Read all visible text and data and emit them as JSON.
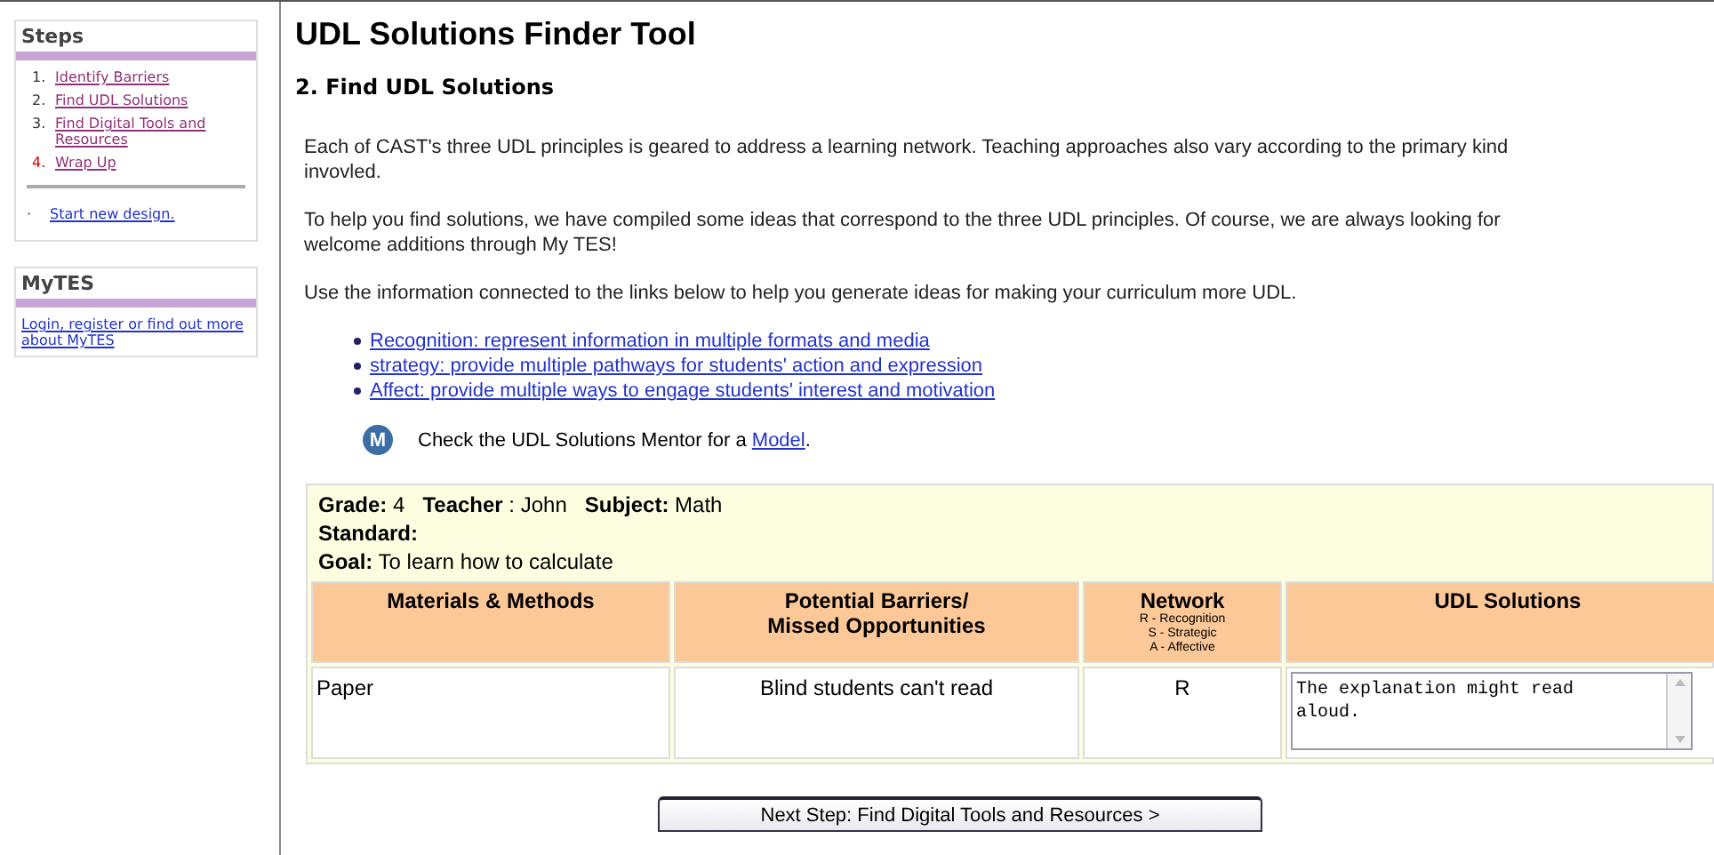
{
  "sidebar": {
    "steps_box": {
      "title": "Steps",
      "steps": [
        {
          "number": "1.",
          "label": "Identify Barriers",
          "highlighted": false
        },
        {
          "number": "2.",
          "label": "Find UDL Solutions",
          "highlighted": false
        },
        {
          "number": "3.",
          "label": "Find Digital Tools and Resources",
          "highlighted": false
        },
        {
          "number": "4.",
          "label": "Wrap Up",
          "highlighted": true
        }
      ],
      "extra_link": {
        "bullet": "·",
        "label": "Start new design."
      }
    },
    "mytes_box": {
      "title": "MyTES",
      "link": "Login, register or find out more about MyTES"
    }
  },
  "main": {
    "title": "UDL Solutions Finder Tool",
    "subtitle": "2. Find UDL Solutions",
    "paragraphs": [
      [
        "Each of CAST's three UDL principles is geared to address a learning network. Teaching approaches also vary according to the primary kind",
        "invovled."
      ],
      [
        "To help you find solutions, we have compiled some ideas that correspond to the three UDL principles. Of course, we are always looking for",
        "welcome additions through My TES!"
      ],
      [
        "Use the information connected to the links below to help you generate ideas for making your curriculum more UDL."
      ]
    ],
    "links": [
      "Recognition: represent information in multiple formats and media",
      "strategy: provide multiple pathways for students' action and expression",
      "Affect: provide multiple ways to engage students' interest and motivation"
    ],
    "mentor": {
      "icon_letter": "M",
      "text": "Check the UDL Solutions Mentor for a ",
      "link": "Model",
      "after": "."
    },
    "plan": {
      "info": [
        {
          "label": "Grade:",
          "value": "4"
        },
        {
          "label": "Teacher",
          "value": ": John"
        },
        {
          "label": "Subject:",
          "value": "Math"
        }
      ],
      "standard_label": "Standard:",
      "goal_label": "Goal:",
      "goal": "To learn how to calculate",
      "columns": [
        "Materials & Methods",
        "Potential Barriers/ Missed Opportunities",
        "Network",
        "UDL Solutions"
      ],
      "network_legend": [
        "R - Recognition",
        "S - Strategic",
        "A - Affective"
      ],
      "rows": [
        {
          "materials": "Paper",
          "barriers": "Blind students can't read",
          "network": "R",
          "solution": "The explanation might read aloud."
        }
      ]
    },
    "next_button": "Next Step: Find Digital Tools and Resources >"
  }
}
